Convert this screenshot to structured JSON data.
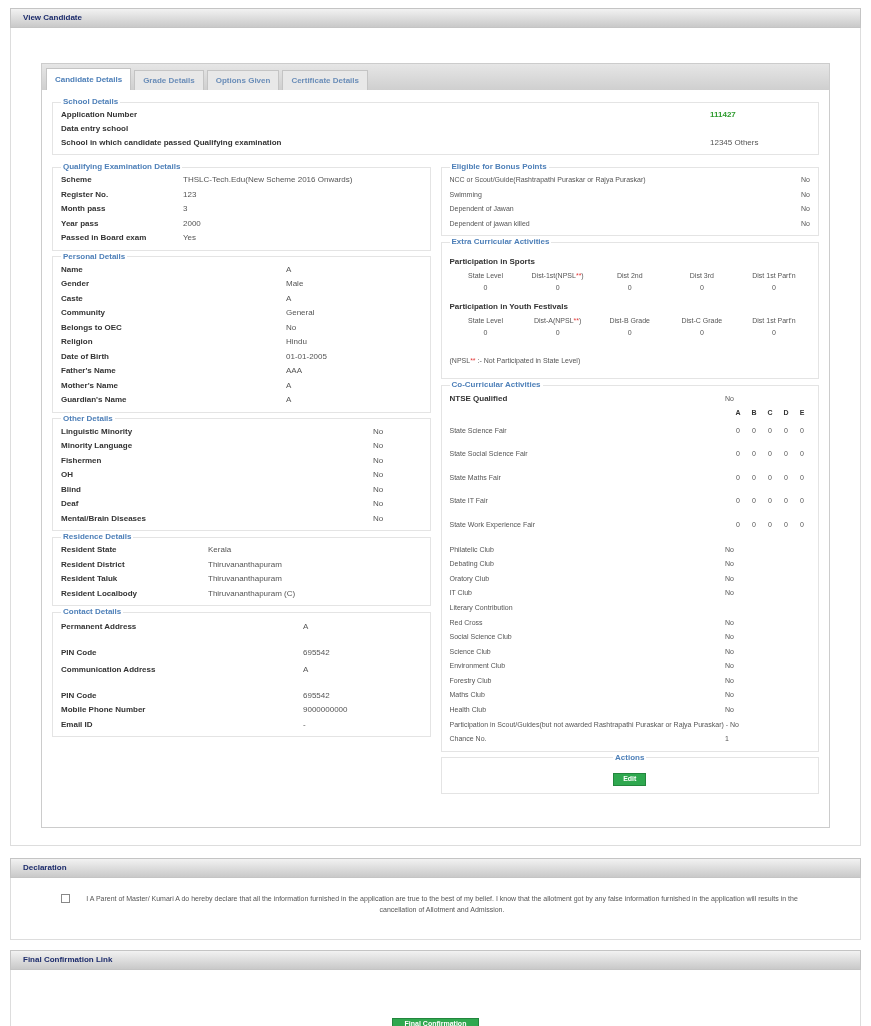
{
  "panel": {
    "title": "View Candidate"
  },
  "tabs": [
    {
      "label": "Candidate Details",
      "selected": true
    },
    {
      "label": "Grade Details",
      "selected": false
    },
    {
      "label": "Options Given",
      "selected": false
    },
    {
      "label": "Certificate Details",
      "selected": false
    }
  ],
  "school_details": {
    "title": "School Details",
    "rows": [
      {
        "label": "Application Number",
        "value": "111427",
        "kind": "highlight"
      },
      {
        "label": "Data entry school"
      },
      {
        "label": "School in which candidate passed Qualifying examination",
        "value": "12345 Others"
      }
    ]
  },
  "left_sections": [
    {
      "title": "Qualifying Examination Details",
      "rows": [
        {
          "label": "Scheme",
          "value": "THSLC-Tech.Edu(New Scheme 2016 Onwards)"
        },
        {
          "label": "Register No.",
          "value": "123"
        },
        {
          "label": "Month pass",
          "value": "3"
        },
        {
          "label": "Year pass",
          "value": "2000"
        },
        {
          "label": "Passed in Board exam",
          "value": "Yes"
        }
      ]
    },
    {
      "title": "Personal Details",
      "rows": [
        {
          "label": "Name",
          "value": "A"
        },
        {
          "label": "Gender",
          "value": "Male"
        },
        {
          "label": "Caste",
          "value": "A"
        },
        {
          "label": "Community",
          "value": "General"
        },
        {
          "label": "Belongs to OEC",
          "value": "No"
        },
        {
          "label": "Religion",
          "value": "Hindu"
        },
        {
          "label": "Date of Birth",
          "value": "01-01-2005"
        },
        {
          "label": "Father's Name",
          "value": "AAA"
        },
        {
          "label": "Mother's Name",
          "value": "A"
        },
        {
          "label": "Guardian's Name",
          "value": "A"
        }
      ]
    },
    {
      "title": "Other Details",
      "rows": [
        {
          "label": "Linguistic Minority",
          "value": "No"
        },
        {
          "label": "Minority Language",
          "value": "No"
        },
        {
          "label": "Fishermen",
          "value": "No"
        },
        {
          "label": "OH",
          "value": "No"
        },
        {
          "label": "Blind",
          "value": "No"
        },
        {
          "label": "Deaf",
          "value": "No"
        },
        {
          "label": "Mental/Brain Diseases",
          "value": "No"
        }
      ]
    },
    {
      "title": "Residence Details",
      "rows": [
        {
          "label": "Resident State",
          "value": "Kerala"
        },
        {
          "label": "Resident District",
          "value": "Thiruvananthapuram"
        },
        {
          "label": "Resident Taluk",
          "value": "Thiruvananthapuram"
        },
        {
          "label": "Resident Localbody",
          "value": "Thiruvananthapuram (C)"
        }
      ]
    },
    {
      "title": "Contact Details",
      "rows": [
        {
          "label": "Permanent Address",
          "value": "A",
          "tall": true
        },
        {
          "label": "PIN Code",
          "value": "695542",
          "tall": false
        },
        {
          "label": "Communication Address",
          "value": "A",
          "tall": true
        },
        {
          "label": "PIN Code",
          "value": "695542",
          "tall": false
        },
        {
          "label": "Mobile Phone Number",
          "value": "9000000000",
          "tall": false
        },
        {
          "label": "Email ID",
          "value": "-",
          "tall": false
        }
      ]
    }
  ],
  "bonus": {
    "title": "Eligible for Bonus Points",
    "rows": [
      {
        "label": "NCC or Scout/Guide(Rashtrapathi Puraskar or Rajya Puraskar)",
        "value": "No"
      },
      {
        "label": "Swimming",
        "value": "No"
      },
      {
        "label": "Dependent of Jawan",
        "value": "No"
      },
      {
        "label": "Dependent of jawan killed",
        "value": "No"
      }
    ]
  },
  "extra_curricular": {
    "title": "Extra Curricular Activities",
    "groups": [
      {
        "title": "Participation in Sports",
        "columns": [
          {
            "label": "State Level",
            "value": "0"
          },
          {
            "label": "Dist-1st(NPSL",
            "star": "**",
            "suffix": ")",
            "value": "0"
          },
          {
            "label": "Dist 2nd",
            "value": "0"
          },
          {
            "label": "Dist 3rd",
            "value": "0"
          },
          {
            "label": "Dist 1st Part'n",
            "value": "0"
          }
        ]
      },
      {
        "title": "Participation in Youth Festivals",
        "columns": [
          {
            "label": "State Level",
            "value": "0"
          },
          {
            "label": "Dist-A(NPSL",
            "star": "**",
            "suffix": ")",
            "value": "0"
          },
          {
            "label": "Dist-B Grade",
            "value": "0"
          },
          {
            "label": "Dist-C Grade",
            "value": "0"
          },
          {
            "label": "Dist 1st Part'n",
            "value": "0"
          }
        ]
      }
    ],
    "note": {
      "label": "(NPSL",
      "star": "**",
      "suffix": " :- Not Participated in State Level)"
    }
  },
  "co_curricular": {
    "title": "Co-Curricular Activities",
    "ntse": {
      "label": "NTSE Qualified",
      "value": "No"
    },
    "grades": [
      "A",
      "B",
      "C",
      "D",
      "E"
    ],
    "fairs": [
      {
        "label": "State Science Fair",
        "values": [
          "0",
          "0",
          "0",
          "0",
          "0"
        ]
      },
      {
        "label": "State Social Science Fair",
        "values": [
          "0",
          "0",
          "0",
          "0",
          "0"
        ]
      },
      {
        "label": "State Maths Fair",
        "values": [
          "0",
          "0",
          "0",
          "0",
          "0"
        ]
      },
      {
        "label": "State IT Fair",
        "values": [
          "0",
          "0",
          "0",
          "0",
          "0"
        ]
      },
      {
        "label": "State Work Experience Fair",
        "values": [
          "0",
          "0",
          "0",
          "0",
          "0"
        ]
      }
    ],
    "clubs": [
      {
        "label": "Philatelic Club",
        "value": "No"
      },
      {
        "label": "Debating Club",
        "value": "No"
      },
      {
        "label": "Oratory Club",
        "value": "No"
      },
      {
        "label": "IT Club",
        "value": "No"
      },
      {
        "label": "Literary Contribution"
      },
      {
        "label": "Red Cross",
        "value": "No"
      },
      {
        "label": "Social Science Club",
        "value": "No"
      },
      {
        "label": "Science Club",
        "value": "No"
      },
      {
        "label": "Environment Club",
        "value": "No"
      },
      {
        "label": "Forestry Club",
        "value": "No"
      },
      {
        "label": "Maths Club",
        "value": "No"
      },
      {
        "label": "Health Club",
        "value": "No"
      }
    ],
    "scout": "Participation in Scout/Guides(but not awarded Rashtrapathi Puraskar or Rajya Puraskar) - No",
    "chance": {
      "label": "Chance No.",
      "value": "1"
    }
  },
  "actions": {
    "title": "Actions",
    "button": "Edit"
  },
  "declaration": {
    "title": "Declaration",
    "checked": false,
    "text": "I A Parent of Master/ Kumari A do hereby declare that all the information furnished in the application are true to the best of my belief. I know that the allotment got by any false information furnished in the application will results in the cancellation of Allotment and Admission."
  },
  "final": {
    "title": "Final Confirmation Link",
    "button": "Final Confirmation"
  }
}
